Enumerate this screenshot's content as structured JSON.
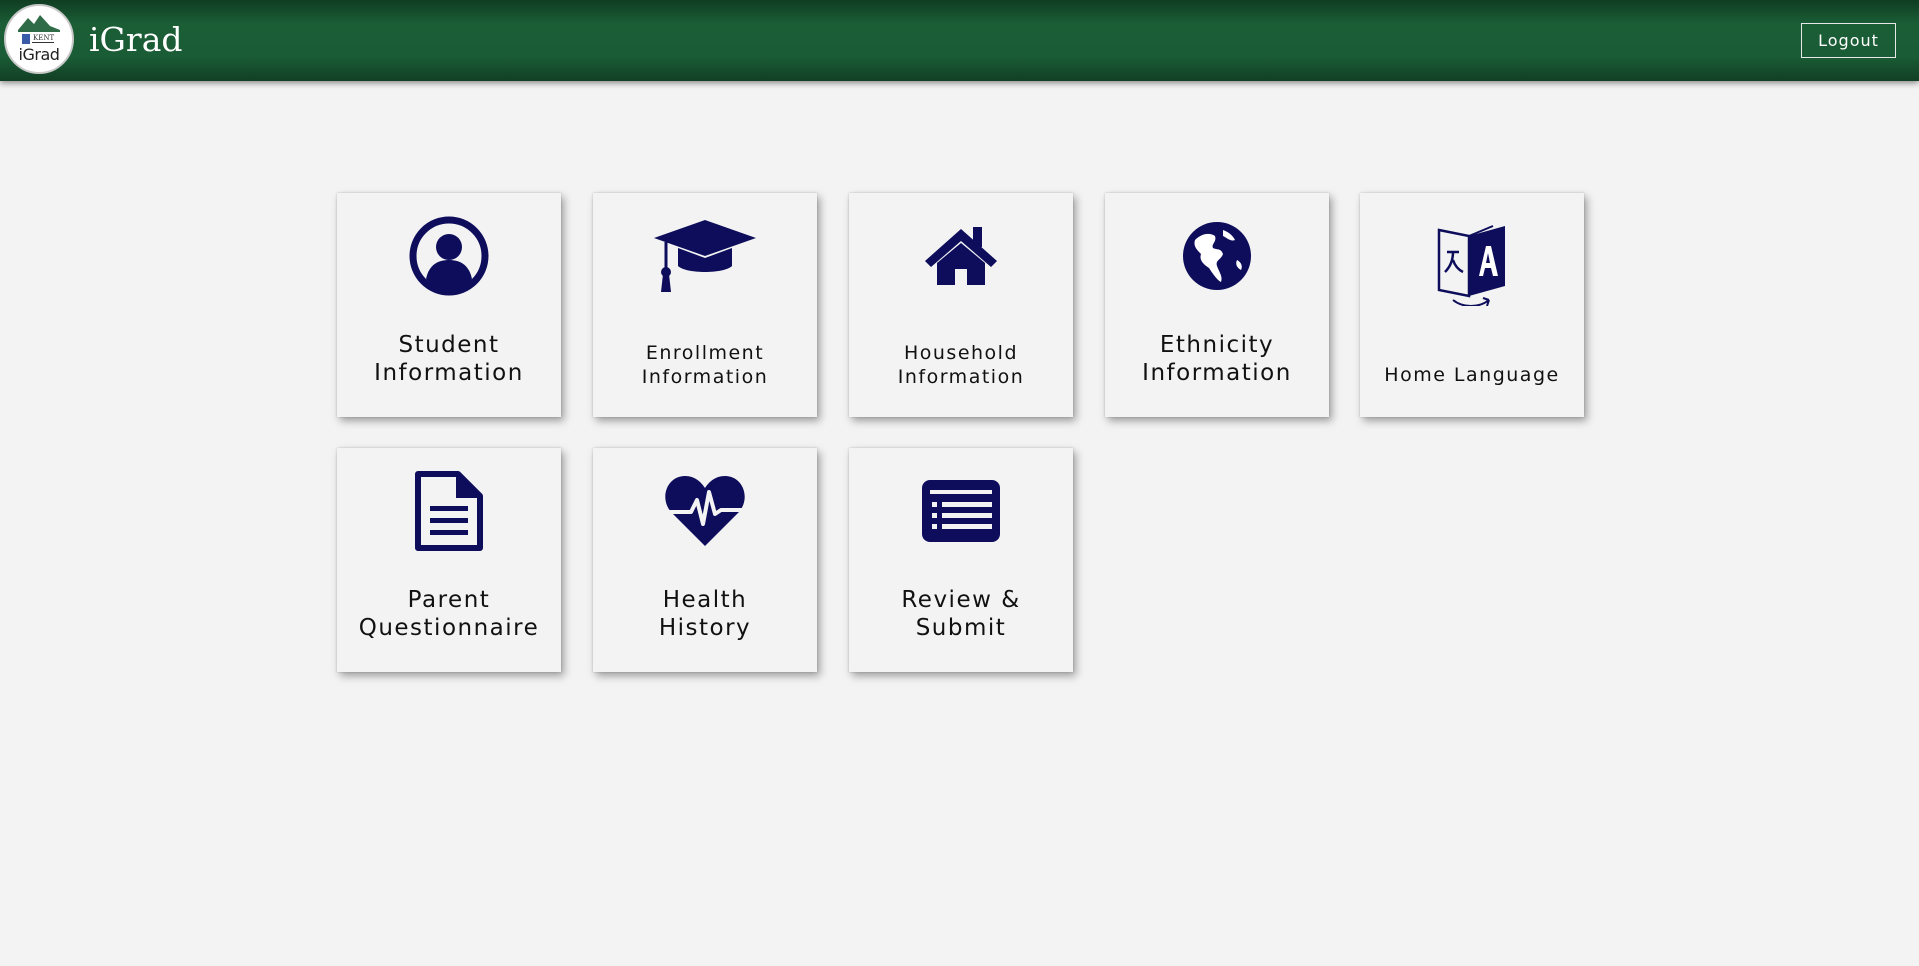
{
  "header": {
    "logo_text": "iGrad",
    "logo_caption": "KENT",
    "title": "iGrad",
    "logout_label": "Logout"
  },
  "colors": {
    "header_green": "#1b5e36",
    "icon_navy": "#0d0d5c",
    "background": "#f3f3f3"
  },
  "tiles": [
    {
      "icon": "user-circle-icon",
      "line1": "Student",
      "line2": "Information"
    },
    {
      "icon": "graduation-cap-icon",
      "line1": "Enrollment",
      "line2": "Information"
    },
    {
      "icon": "house-icon",
      "line1": "Household",
      "line2": "Information"
    },
    {
      "icon": "globe-icon",
      "line1": "Ethnicity",
      "line2": "Information"
    },
    {
      "icon": "translate-icon",
      "line1": "Home Language"
    },
    {
      "icon": "document-icon",
      "line1": "Parent",
      "line2": "Questionnaire"
    },
    {
      "icon": "heart-pulse-icon",
      "line1": "Health",
      "line2": "History"
    },
    {
      "icon": "list-card-icon",
      "line1": "Review &",
      "line2": "Submit"
    }
  ]
}
